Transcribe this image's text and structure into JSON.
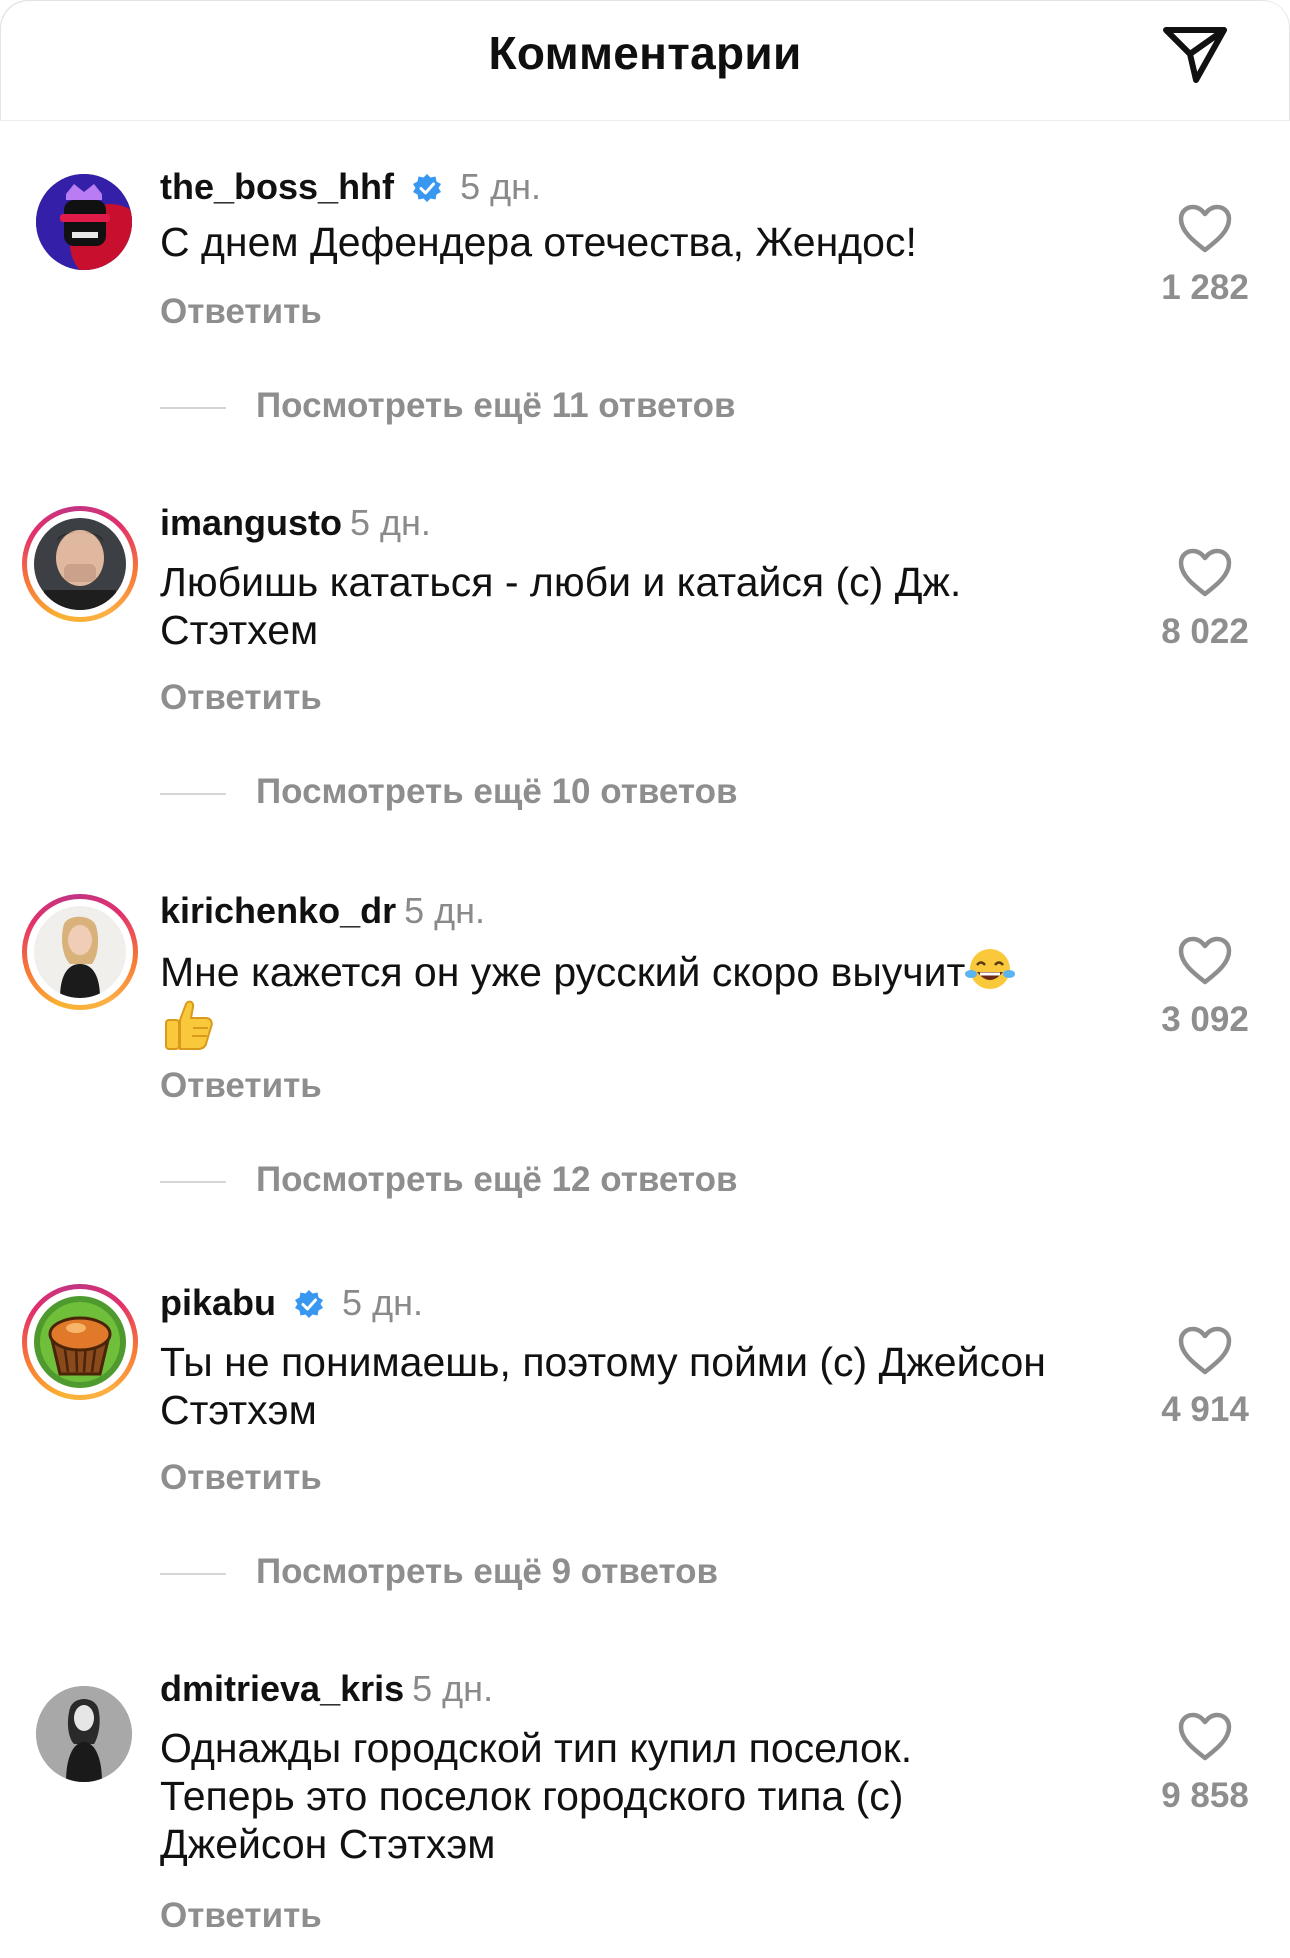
{
  "header": {
    "title": "Комментарии",
    "send_icon": "paper-plane-icon"
  },
  "colors": {
    "verified": "#3897f0",
    "muted": "#8e8e8e",
    "story_ring": [
      "#f9b233",
      "#e1306c",
      "#c13584"
    ]
  },
  "comments": [
    {
      "username": "the_boss_hhf",
      "verified": true,
      "time": "5 дн.",
      "text": "С днем Дефендера отечества, Жендос!",
      "reply_label": "Ответить",
      "likes": "1 282",
      "more_replies": "Посмотреть ещё 11 ответов",
      "story_ring": false
    },
    {
      "username": "imangusto",
      "verified": false,
      "time": "5 дн.",
      "text": "Любишь кататься - люби и катайся (с) Дж. Стэтхем",
      "reply_label": "Ответить",
      "likes": "8 022",
      "more_replies": "Посмотреть ещё 10 ответов",
      "story_ring": true
    },
    {
      "username": "kirichenko_dr",
      "verified": false,
      "time": "5 дн.",
      "text": "Мне кажется он уже русский скоро выучит",
      "emojis": [
        "tears-of-joy-emoji",
        "thumbs-up-emoji"
      ],
      "reply_label": "Ответить",
      "likes": "3 092",
      "more_replies": "Посмотреть ещё 12 ответов",
      "story_ring": true
    },
    {
      "username": "pikabu",
      "verified": true,
      "time": "5 дн.",
      "text": "Ты не понимаешь, поэтому пойми (с) Джейсон Стэтхэм",
      "reply_label": "Ответить",
      "likes": "4 914",
      "more_replies": "Посмотреть ещё 9 ответов",
      "story_ring": true
    },
    {
      "username": "dmitrieva_kris",
      "verified": false,
      "time": "5 дн.",
      "text": "Однажды городской тип купил поселок. Теперь это поселок городского типа (с) Джейсон Стэтхэм",
      "reply_label": "Ответить",
      "likes": "9 858",
      "story_ring": false
    }
  ]
}
